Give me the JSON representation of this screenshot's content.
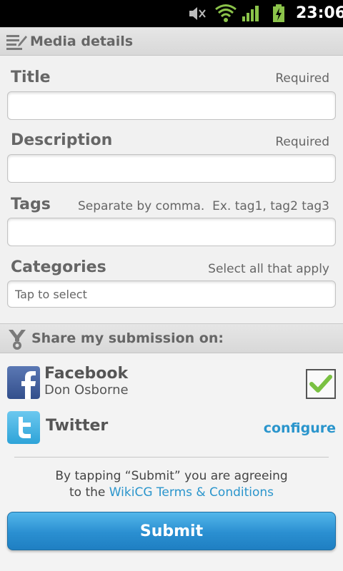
{
  "status_bar": {
    "time": "23:06"
  },
  "media_section": {
    "title": "Media details"
  },
  "fields": {
    "title": {
      "label": "Title",
      "hint": "Required",
      "value": ""
    },
    "description": {
      "label": "Description",
      "hint": "Required",
      "value": ""
    },
    "tags": {
      "label": "Tags",
      "hint": "Separate by comma.  Ex. tag1, tag2 tag3",
      "value": ""
    },
    "categories": {
      "label": "Categories",
      "hint": "Select all that apply",
      "placeholder": "Tap to select",
      "value": ""
    }
  },
  "share_section": {
    "title": "Share my submission on:"
  },
  "facebook": {
    "name": "Facebook",
    "user": "Don Osborne",
    "checked": true
  },
  "twitter": {
    "name": "Twitter",
    "action": "configure"
  },
  "terms": {
    "line1": "By tapping “Submit” you are agreeing",
    "line2_prefix": "to the ",
    "link": "WikiCG Terms & Conditions"
  },
  "submit": {
    "label": "Submit"
  },
  "colors": {
    "accent": "#2a95cc",
    "button": "#2a8fd1",
    "check": "#7ac142"
  }
}
